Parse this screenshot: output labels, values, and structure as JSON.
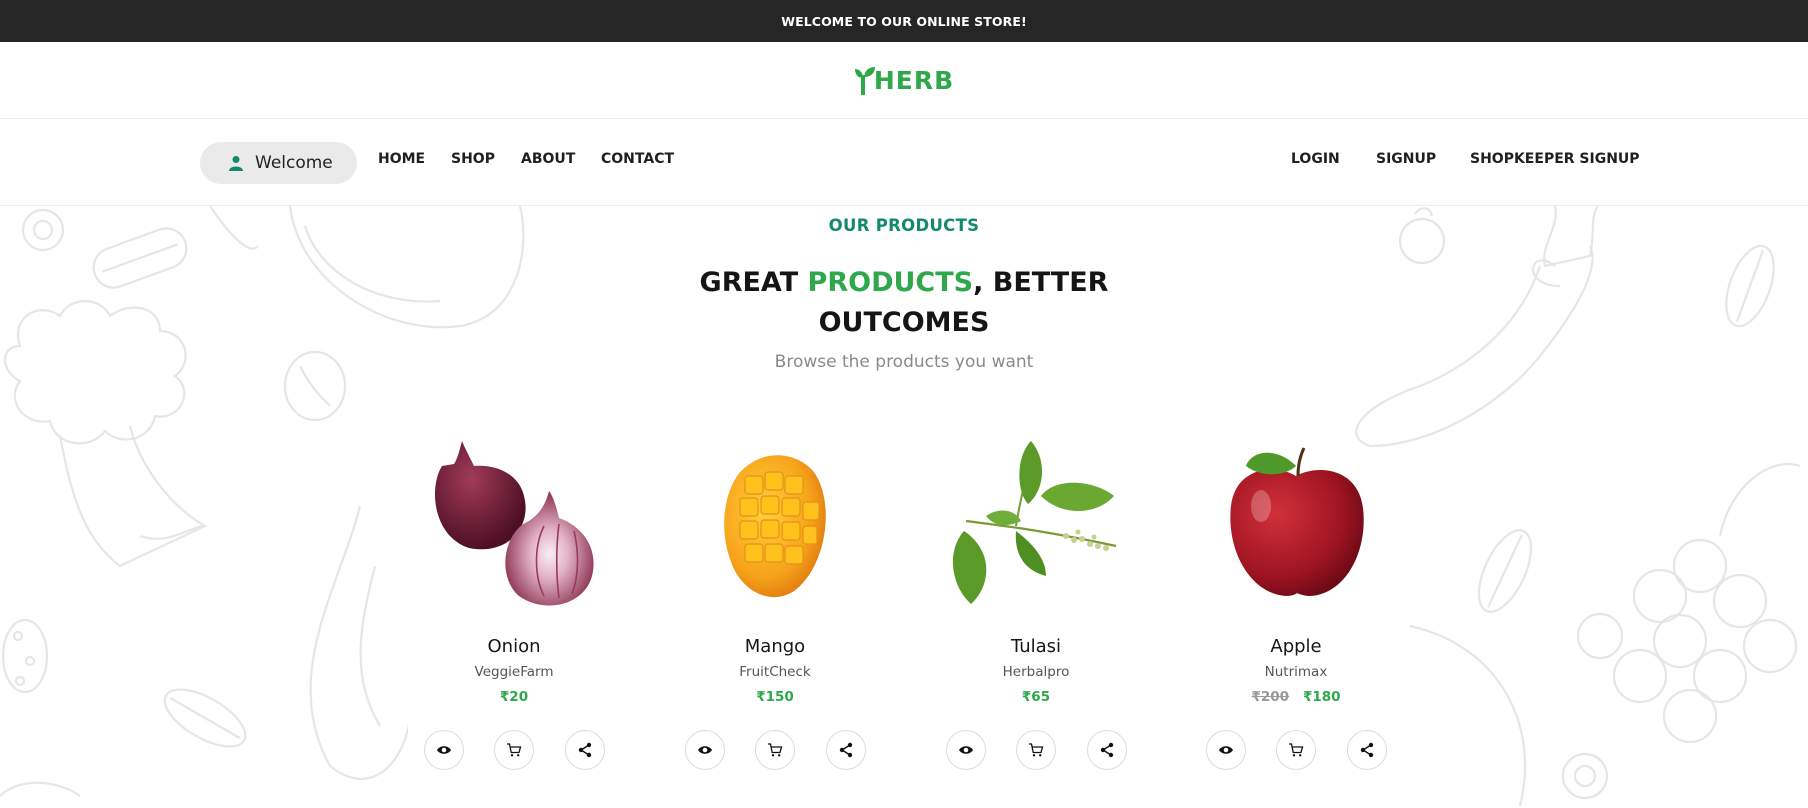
{
  "announcement": "WELCOME TO OUR ONLINE STORE!",
  "brand": {
    "logo_text": "HERB",
    "accent_color": "#2ea84a"
  },
  "nav": {
    "welcome_label": "Welcome",
    "left_links": [
      "HOME",
      "SHOP",
      "ABOUT",
      "CONTACT"
    ],
    "right_links": [
      "LOGIN",
      "SIGNUP",
      "SHOPKEEPER SIGNUP"
    ]
  },
  "section": {
    "kicker": "OUR PRODUCTS",
    "headline_part1": "GREAT ",
    "headline_highlight": "PRODUCTS",
    "headline_part2": ", BETTER",
    "headline_line2": "OUTCOMES",
    "subtitle": "Browse the products you want"
  },
  "products": [
    {
      "name": "Onion",
      "brand": "VeggieFarm",
      "price": "₹20",
      "old_price": "",
      "image": "onion"
    },
    {
      "name": "Mango",
      "brand": "FruitCheck",
      "price": "₹150",
      "old_price": "",
      "image": "mango"
    },
    {
      "name": "Tulasi",
      "brand": "Herbalpro",
      "price": "₹65",
      "old_price": "",
      "image": "tulasi-leaves"
    },
    {
      "name": "Apple",
      "brand": "Nutrimax",
      "price": "₹180",
      "old_price": "₹200",
      "image": "apple"
    }
  ],
  "action_icons": [
    "eye-icon",
    "cart-icon",
    "share-icon"
  ],
  "colors": {
    "topbar": "#262626",
    "kicker": "#138a6c",
    "green": "#2ea84a"
  }
}
